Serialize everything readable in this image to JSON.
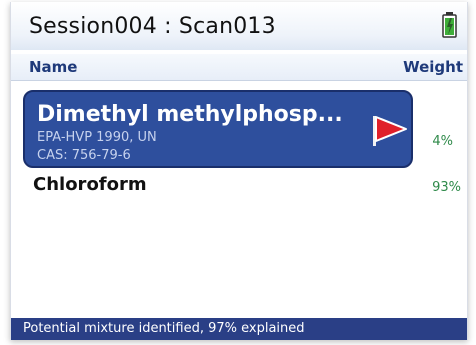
{
  "window": {
    "title": "Session004 : Scan013"
  },
  "columns": {
    "name": "Name",
    "weight": "Weight"
  },
  "results": [
    {
      "name": "Dimethyl methylphosp...",
      "source": "EPA-HVP 1990, UN",
      "cas": "CAS: 756-79-6",
      "weight": "4%",
      "flag_icon": "red-flag-icon",
      "selected": true
    },
    {
      "name": "Chloroform",
      "weight": "93%",
      "selected": false
    }
  ],
  "status": {
    "text": "Potential mixture identified, 97% explained"
  },
  "colors": {
    "selection": "#2e4f9d",
    "status_bar": "#2a3f86",
    "flag": "#e0202a",
    "weight_text": "#2f8a4a"
  }
}
